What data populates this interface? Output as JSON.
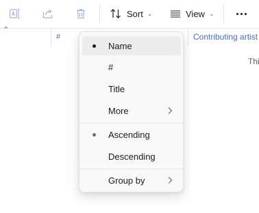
{
  "toolbar": {
    "icons": [
      "rename-icon",
      "share-icon",
      "delete-icon"
    ],
    "sort_label": "Sort",
    "view_label": "View"
  },
  "columns": {
    "number_header": "#",
    "contributing_artist_header": "Contributing artist"
  },
  "content": {
    "partial_cell_text": "Thi"
  },
  "sort_menu": {
    "items": [
      {
        "label": "Name",
        "checked": true
      },
      {
        "label": "#",
        "checked": false
      },
      {
        "label": "Title",
        "checked": false
      },
      {
        "label": "More",
        "checked": false,
        "submenu": true
      }
    ],
    "order_items": [
      {
        "label": "Ascending",
        "checked": true
      },
      {
        "label": "Descending",
        "checked": false
      }
    ],
    "group_item": {
      "label": "Group by",
      "submenu": true
    }
  },
  "colors": {
    "accent_link": "#4a6cb5",
    "disabled_icon": "#9db4d8",
    "menu_bg": "#f9f9f9",
    "selected_bg": "#ececec"
  }
}
